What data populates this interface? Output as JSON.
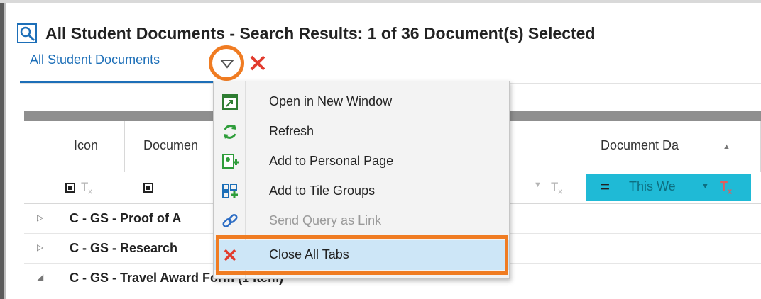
{
  "window": {
    "title": "All Student Documents - Search Results: 1 of 36 Document(s) Selected"
  },
  "tabs": [
    {
      "label": "All Student Documents"
    }
  ],
  "grid": {
    "headers": {
      "icon": "Icon",
      "document": "Documen",
      "document_date": "Document Da"
    },
    "date_filter": {
      "operator": "=",
      "value": "This We"
    },
    "groups": [
      {
        "label": "C - GS - Proof of A",
        "expanded": false
      },
      {
        "label": "C - GS - Research",
        "expanded": false
      },
      {
        "label": "C - GS - Travel Award Form (1 item)",
        "expanded": true
      }
    ]
  },
  "context_menu": {
    "items": [
      {
        "label": "Open in New Window",
        "icon": "open-window-icon",
        "enabled": true
      },
      {
        "label": "Refresh",
        "icon": "refresh-icon",
        "enabled": true
      },
      {
        "label": "Add to Personal Page",
        "icon": "add-page-icon",
        "enabled": true
      },
      {
        "label": "Add to Tile Groups",
        "icon": "tile-groups-icon",
        "enabled": true
      },
      {
        "label": "Send Query as Link",
        "icon": "link-icon",
        "enabled": false
      },
      {
        "label": "Close All Tabs",
        "icon": "close-icon",
        "enabled": true,
        "highlighted": true
      }
    ]
  },
  "colors": {
    "accent": "#1d6fb8",
    "highlight_ring": "#f07c22",
    "filter_active": "#1fbad6",
    "menu_hover": "#cde6f7"
  }
}
